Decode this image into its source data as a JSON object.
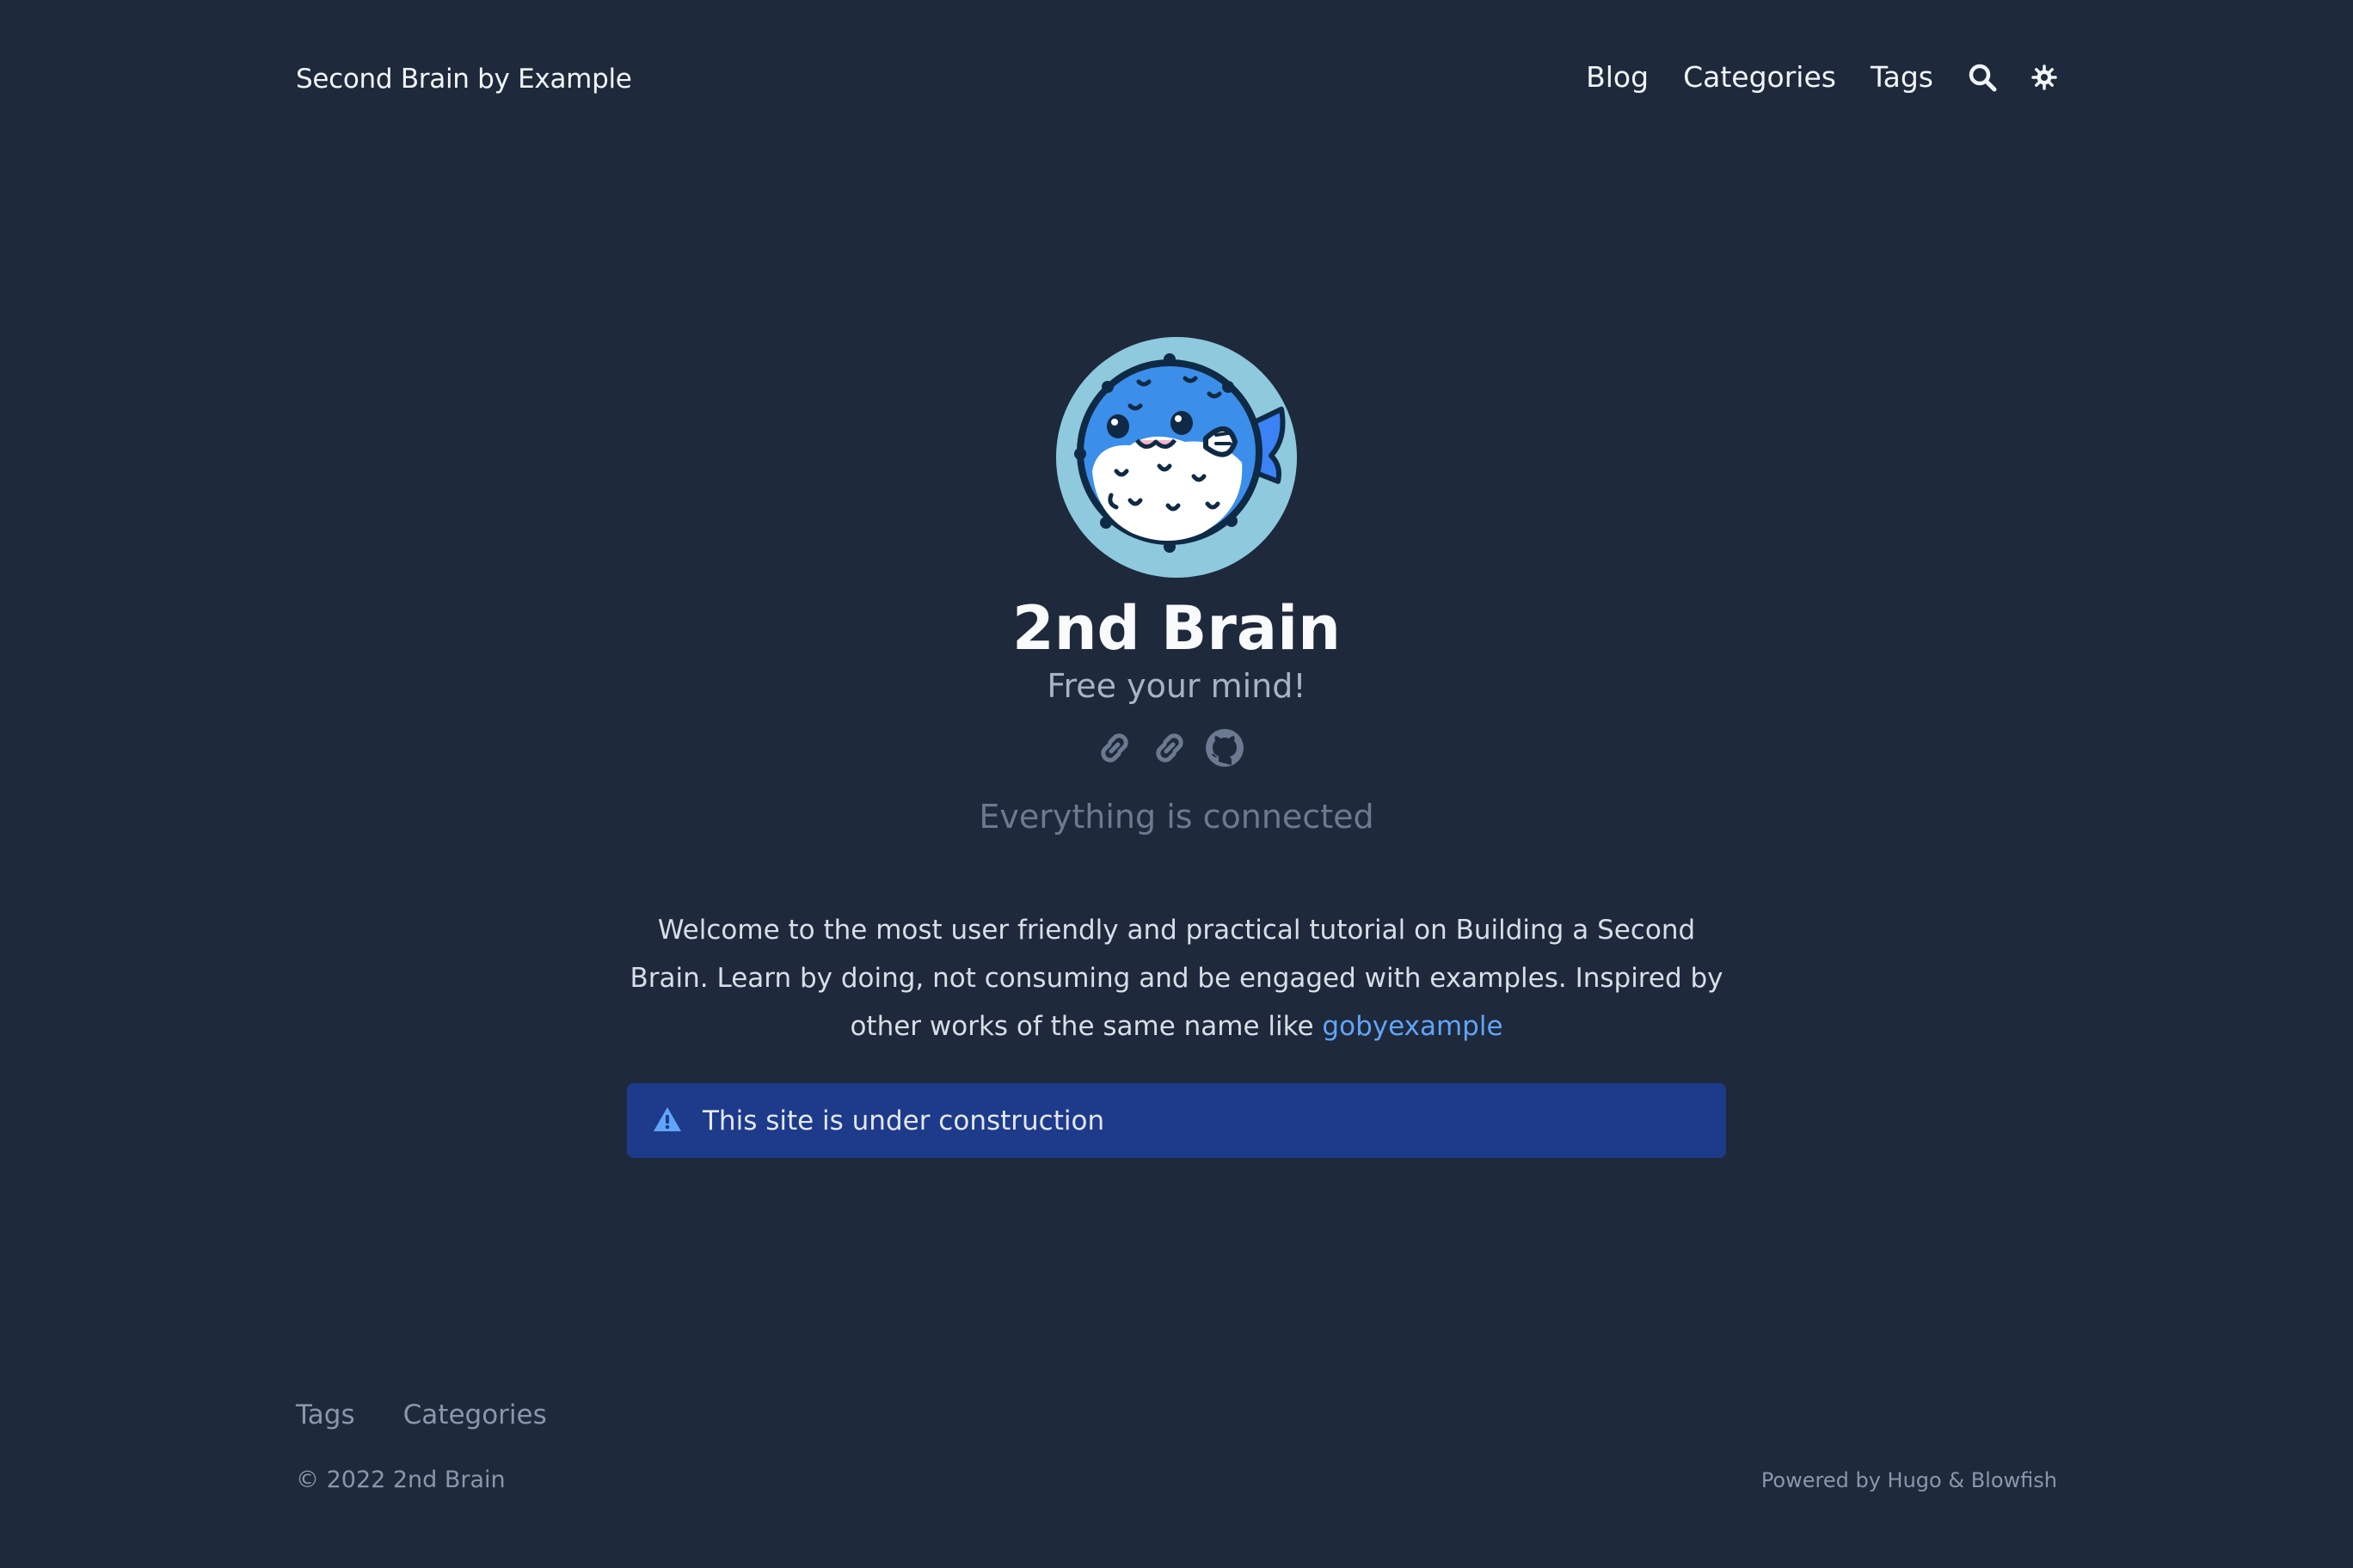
{
  "header": {
    "site_title": "Second Brain by Example",
    "nav": [
      "Blog",
      "Categories",
      "Tags"
    ],
    "icons": [
      "search-icon",
      "theme-toggle-icon"
    ]
  },
  "hero": {
    "title": "2nd Brain",
    "subtitle": "Free your mind!",
    "link_icons": [
      "link-icon",
      "link-icon",
      "github-icon"
    ],
    "tagline": "Everything is connected"
  },
  "intro": {
    "text": "Welcome to the most user friendly and practical tutorial on Building a Second Brain. Learn by doing, not consuming and be engaged with examples. Inspired by other works of the same name like ",
    "link_label": "gobyexample"
  },
  "alert": {
    "icon": "warning-icon",
    "text": "This site is under construction"
  },
  "footer": {
    "nav": [
      "Tags",
      "Categories"
    ],
    "copyright": "© 2022 2nd Brain",
    "powered_prefix": "Powered by ",
    "powered_hugo": "Hugo",
    "powered_sep": " & ",
    "powered_blowfish": "Blowfish"
  },
  "colors": {
    "background": "#1e293b",
    "link": "#60a5fa",
    "alert_bg": "#1e3a8a",
    "avatar_bg": "#8ec9dd"
  }
}
